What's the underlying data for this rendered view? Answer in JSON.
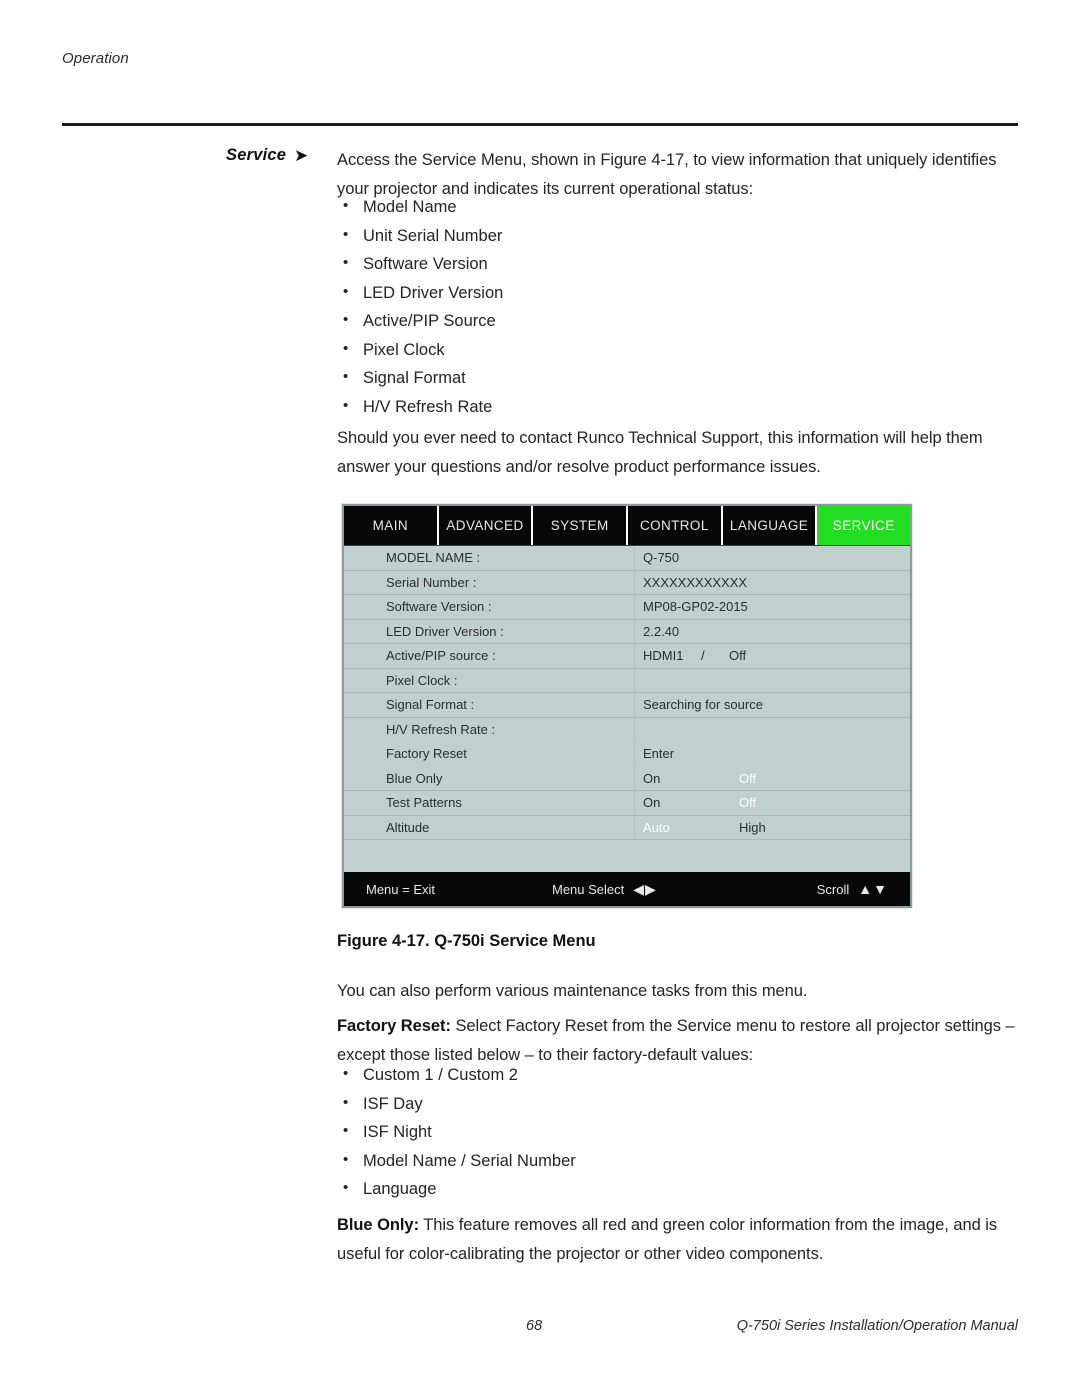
{
  "running_header": "Operation",
  "side_label": {
    "text": "Service",
    "arrow_icon": "right-arrow-icon"
  },
  "intro": {
    "paragraph": "Access the Service Menu, shown in Figure 4-17, to view information that uniquely identifies your projector and indicates its current operational status:",
    "items": [
      "Model Name",
      "Unit Serial Number",
      "Software Version",
      "LED Driver Version",
      "Active/PIP Source",
      "Pixel Clock",
      "Signal Format",
      "H/V Refresh Rate"
    ],
    "support_paragraph": "Should you ever need to contact Runco Technical Support, this information will help them answer your questions and/or resolve product performance issues."
  },
  "osd": {
    "accent_color": "#22dd22",
    "background_color": "#c2cfcf",
    "tabs": [
      {
        "label": "MAIN",
        "active": false
      },
      {
        "label": "ADVANCED",
        "active": false
      },
      {
        "label": "SYSTEM",
        "active": false
      },
      {
        "label": "CONTROL",
        "active": false
      },
      {
        "label": "LANGUAGE",
        "active": false
      },
      {
        "label": "SERVICE",
        "active": true
      }
    ],
    "rows": [
      {
        "label": "MODEL NAME :",
        "value": "Q-750"
      },
      {
        "label": "Serial Number :",
        "value": "XXXXXXXXXXXX"
      },
      {
        "label": "Software Version :",
        "value": "MP08-GP02-2015"
      },
      {
        "label": "LED Driver Version :",
        "value": "2.2.40"
      },
      {
        "label": "Active/PIP source :",
        "value": "HDMI1",
        "value2": "/",
        "value3": "Off"
      },
      {
        "label": "Pixel Clock :",
        "value": ""
      },
      {
        "label": "Signal Format :",
        "value": "Searching for source"
      },
      {
        "label": "H/V Refresh Rate :",
        "value": ""
      },
      {
        "label": "Factory Reset",
        "value": "Enter"
      },
      {
        "label": "Blue Only",
        "option1": "On",
        "option2": "Off",
        "selected": 2
      },
      {
        "label": "Test Patterns",
        "option1": "On",
        "option2": "Off",
        "selected": 2
      },
      {
        "label": "Altitude",
        "option1": "Auto",
        "option2": "High",
        "selected": 1
      }
    ],
    "footer": {
      "exit": "Menu = Exit",
      "menu_select": "Menu Select",
      "menu_select_glyphs": "◀▶",
      "scroll": "Scroll",
      "scroll_glyphs": "▲▼"
    }
  },
  "figure_caption": "Figure 4-17. Q-750i Service Menu",
  "maintenance": {
    "intro": "You can also perform various maintenance tasks from this menu.",
    "factory_reset_label": "Factory Reset:",
    "factory_reset_text": " Select Factory Reset from the Service menu to restore all projector settings – except those listed below – to their factory-default values:",
    "exceptions": [
      "Custom 1 / Custom 2",
      "ISF Day",
      "ISF Night",
      "Model Name / Serial Number",
      "Language"
    ],
    "blue_only_label": "Blue Only:",
    "blue_only_text": " This feature removes all red and green color information from the image, and is useful for color-calibrating the projector or other video components."
  },
  "page_footer": {
    "page_number": "68",
    "manual_title": "Q-750i Series Installation/Operation Manual"
  }
}
